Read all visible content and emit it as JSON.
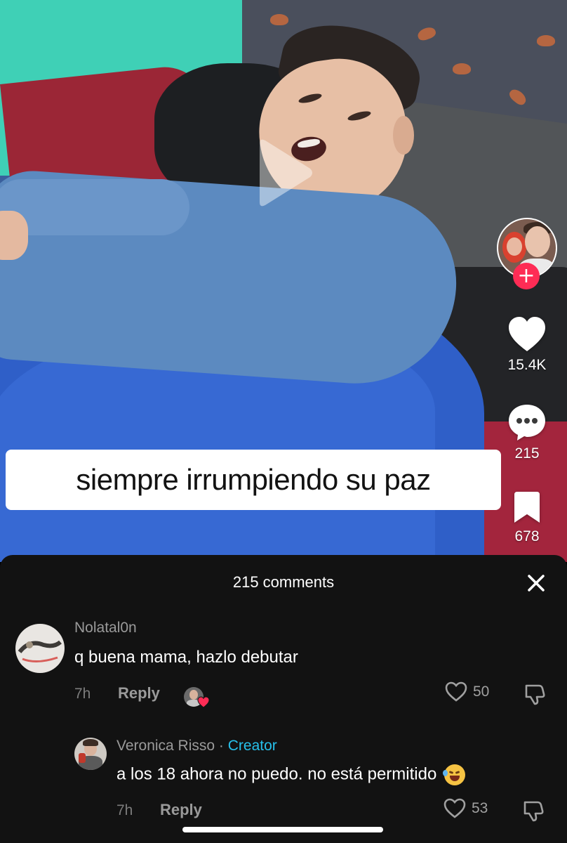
{
  "video": {
    "caption": "siempre irrumpiendo su paz",
    "play_icon": "play-icon"
  },
  "rail": {
    "follow_label": "+",
    "likes": "15.4K",
    "comments": "215",
    "saves": "678",
    "icons": [
      "heart-icon",
      "comment-icon",
      "bookmark-icon"
    ],
    "accent_color": "#fe2c55"
  },
  "comments_sheet": {
    "title": "215 comments",
    "close_icon": "close-icon",
    "items": [
      {
        "username": "Nolatal0n",
        "text": "q buena mama, hazlo debutar",
        "time": "7h",
        "reply_label": "Reply",
        "likes": "50",
        "liked_by_creator": true
      },
      {
        "username": "Veronica Risso",
        "separator": "·",
        "badge": "Creator",
        "text": "a los 18 ahora no puedo. no está permitido",
        "emoji": "rolling-on-floor-laughing",
        "time": "7h",
        "reply_label": "Reply",
        "likes": "53"
      }
    ],
    "creator_color": "#27c0ea"
  }
}
